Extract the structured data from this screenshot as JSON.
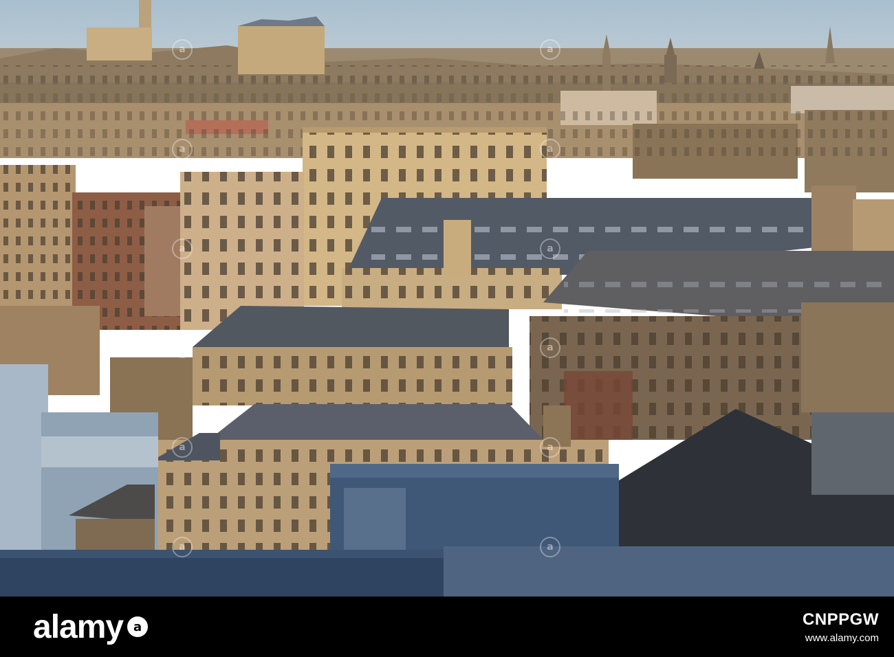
{
  "photo": {
    "subject": "skyline-of-stone-mill-buildings",
    "palette": {
      "sky": "#b7c8d4",
      "stone_lit": "#c9a874",
      "stone_shadow": "#6d5a44",
      "roof_slate": "#5b5f68",
      "foreground_blue": "#3d5b7a"
    }
  },
  "watermark": {
    "glyph": "a"
  },
  "footer": {
    "brand": "alamy",
    "brand_mark": "a",
    "image_id": "CNPPGW",
    "url": "www.alamy.com"
  }
}
